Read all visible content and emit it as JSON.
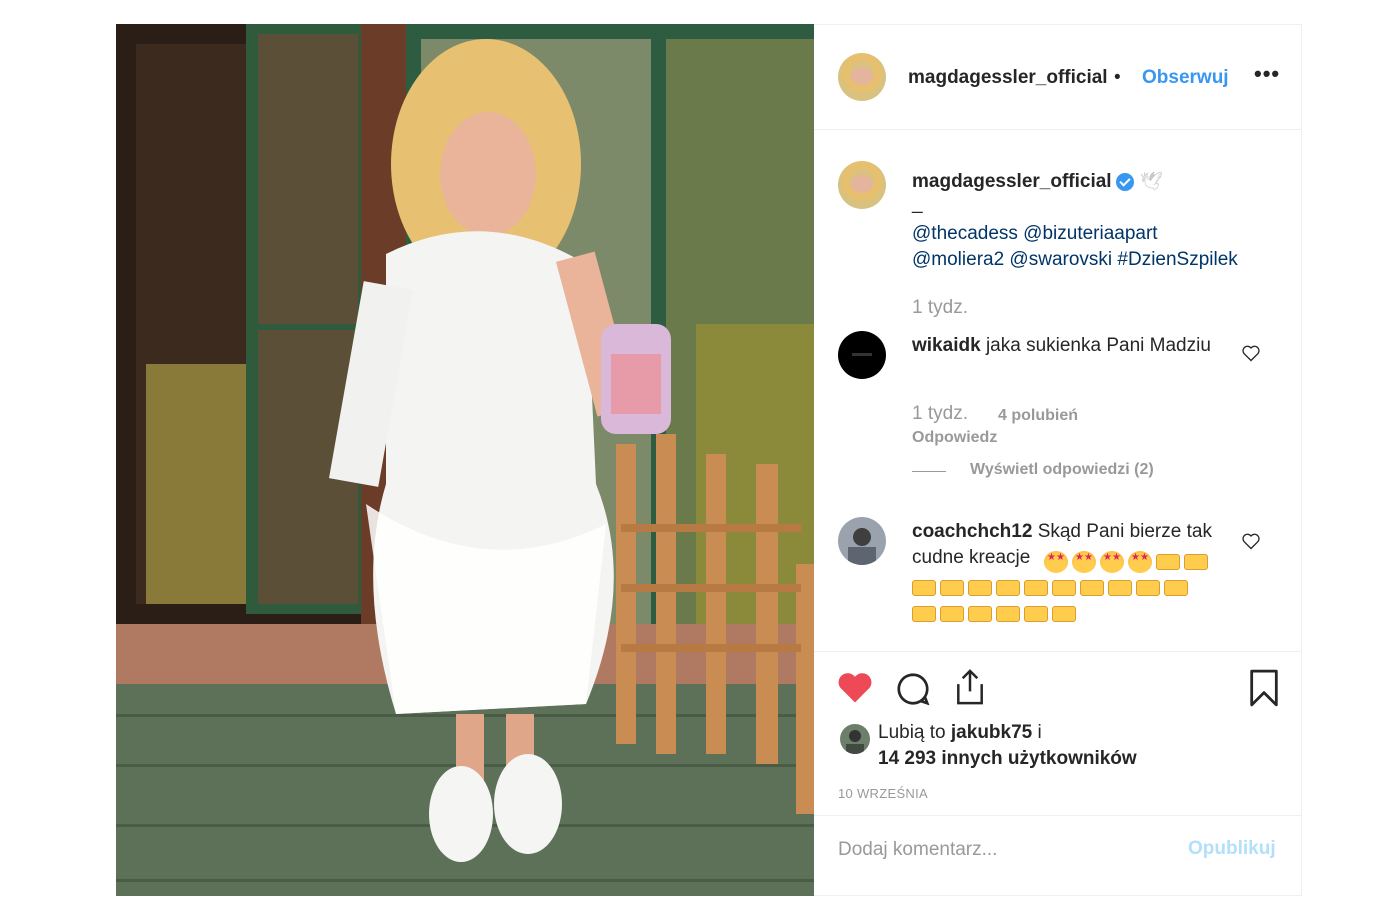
{
  "post": {
    "author": "magdagessler_official",
    "follow_label": "Obserwuj",
    "dot": "•",
    "more_label": "•••"
  },
  "caption": {
    "user": "magdagessler_official",
    "dash": "_",
    "line1": "@thecadess @bizuteriaapart",
    "line2": "@moliera2 @swarovski #DzienSzpilek",
    "time": "1 tydz."
  },
  "comments": [
    {
      "user": "wikaidk",
      "text": "jaka sukienka Pani Madziu",
      "time": "1 tydz.",
      "likes": "4 polubień",
      "reply_label": "Odpowiedz",
      "view_replies": "Wyświetl odpowiedzi (2)"
    },
    {
      "user": "coachchch12",
      "text": "Skąd Pani bierze tak cudne kreacje"
    }
  ],
  "likes": {
    "prefix": "Lubią to",
    "user": "jakubk75",
    "suffix": "i",
    "others": "14 293 innych użytkowników"
  },
  "date": "10 WRZEŚNIA",
  "add_comment": {
    "placeholder": "Dodaj komentarz...",
    "post_label": "Opublikuj"
  },
  "colors": {
    "accent": "#3897f0",
    "liked_heart": "#ed4956",
    "muted": "#999999"
  },
  "icons": [
    "heart-icon",
    "comment-icon",
    "share-icon",
    "bookmark-icon",
    "verified-icon",
    "more-icon"
  ]
}
